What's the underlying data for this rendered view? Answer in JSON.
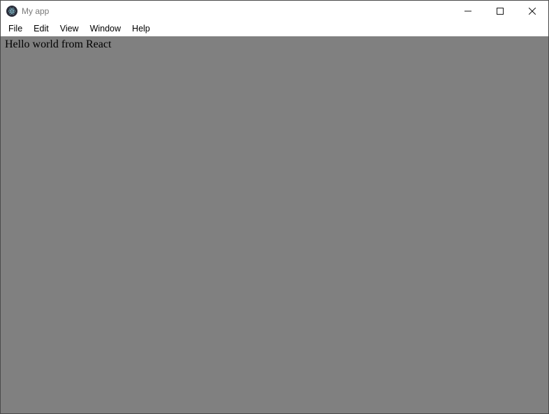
{
  "window": {
    "title": "My app"
  },
  "menubar": {
    "items": [
      {
        "label": "File"
      },
      {
        "label": "Edit"
      },
      {
        "label": "View"
      },
      {
        "label": "Window"
      },
      {
        "label": "Help"
      }
    ]
  },
  "content": {
    "message": "Hello world from React"
  }
}
